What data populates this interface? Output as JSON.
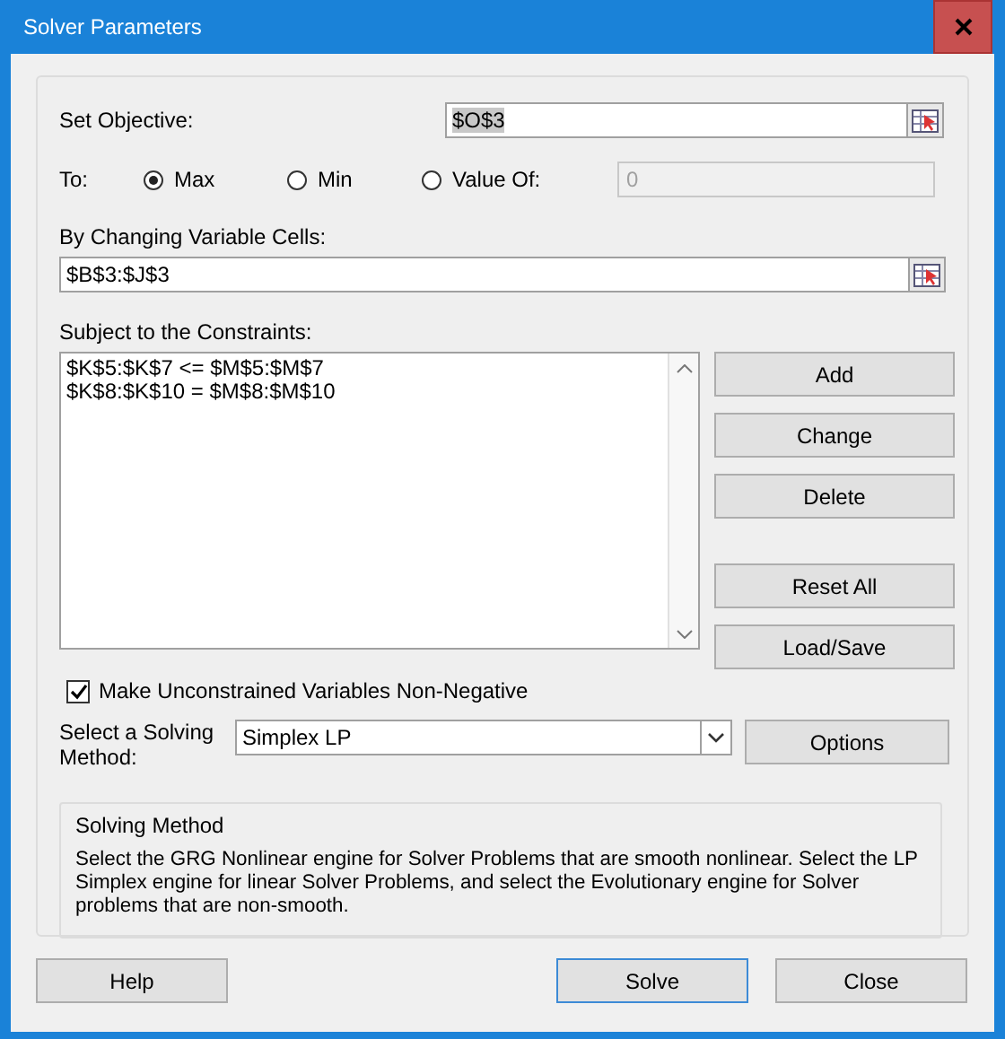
{
  "window": {
    "title": "Solver Parameters"
  },
  "objective": {
    "label": "Set Objective:",
    "value": "$O$3",
    "text_selected": true
  },
  "to": {
    "label": "To:",
    "options": [
      {
        "label": "Max",
        "selected": true
      },
      {
        "label": "Min",
        "selected": false
      },
      {
        "label": "Value Of:",
        "selected": false
      }
    ],
    "value_field": {
      "value": "0",
      "disabled": true
    }
  },
  "changing": {
    "label": "By Changing Variable Cells:",
    "value": "$B$3:$J$3"
  },
  "constraints": {
    "label": "Subject to the Constraints:",
    "items": [
      "$K$5:$K$7 <= $M$5:$M$7",
      "$K$8:$K$10 = $M$8:$M$10"
    ]
  },
  "edit_buttons": [
    "Add",
    "Change",
    "Delete"
  ],
  "file_buttons": [
    "Reset All",
    "Load/Save"
  ],
  "nonnegative": {
    "label": "Make Unconstrained Variables Non-Negative",
    "checked": true
  },
  "method": {
    "label": "Select a Solving Method:",
    "value": "Simplex LP",
    "options_button": "Options"
  },
  "info": {
    "title": "Solving Method",
    "text": "Select the GRG Nonlinear engine for Solver Problems that are smooth nonlinear. Select the LP Simplex engine for linear Solver Problems, and select the Evolutionary engine for Solver problems that are non-smooth."
  },
  "footer": [
    {
      "label": "Help",
      "default": false
    },
    {
      "label": "Solve",
      "default": true
    },
    {
      "label": "Close",
      "default": false
    }
  ]
}
